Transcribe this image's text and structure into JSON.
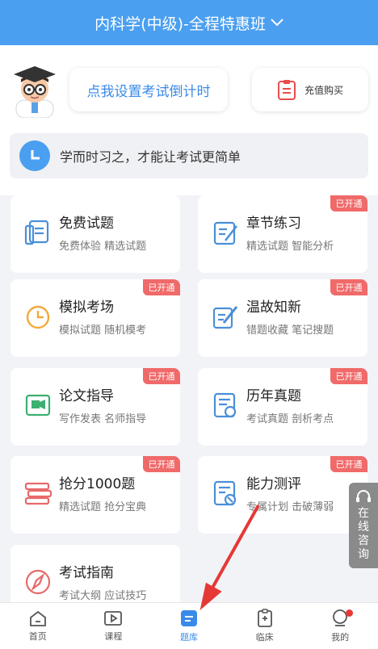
{
  "header": {
    "title": "内科学(中级)-全程特惠班"
  },
  "top": {
    "countdown_label": "点我设置考试倒计时",
    "recharge_label": "充值购买",
    "motto": "学而时习之，才能让考试更简单"
  },
  "cards": [
    {
      "title": "免费试题",
      "sub": "免费体验 精选试题",
      "badge": "",
      "icon": "free-questions-icon"
    },
    {
      "title": "章节练习",
      "sub": "精选试题 智能分析",
      "badge": "已开通",
      "icon": "chapter-practice-icon"
    },
    {
      "title": "模拟考场",
      "sub": "模拟试题 随机模考",
      "badge": "已开通",
      "icon": "clock-icon"
    },
    {
      "title": "温故知新",
      "sub": "错题收藏 笔记搜题",
      "badge": "已开通",
      "icon": "edit-notes-icon"
    },
    {
      "title": "论文指导",
      "sub": "写作发表 名师指导",
      "badge": "已开通",
      "icon": "video-icon"
    },
    {
      "title": "历年真题",
      "sub": "考试真题 剖析考点",
      "badge": "已开通",
      "icon": "past-papers-icon"
    },
    {
      "title": "抢分1000题",
      "sub": "精选试题 抢分宝典",
      "badge": "已开通",
      "icon": "books-stack-icon"
    },
    {
      "title": "能力测评",
      "sub": "专属计划 击破薄弱",
      "badge": "已开通",
      "icon": "assessment-icon"
    },
    {
      "title": "考试指南",
      "sub": "考试大纲 应试技巧",
      "badge": "",
      "icon": "compass-icon"
    }
  ],
  "consult": {
    "chars": [
      "在",
      "线",
      "咨",
      "询"
    ]
  },
  "tabs": [
    {
      "label": "首页",
      "icon": "home-icon"
    },
    {
      "label": "课程",
      "icon": "play-icon"
    },
    {
      "label": "题库",
      "icon": "question-bank-icon",
      "active": true
    },
    {
      "label": "临床",
      "icon": "clipboard-icon"
    },
    {
      "label": "我的",
      "icon": "profile-icon"
    }
  ],
  "colors": {
    "primary": "#4a9ff0",
    "badge": "#f06a6a",
    "annotation_arrow": "#e53935"
  }
}
